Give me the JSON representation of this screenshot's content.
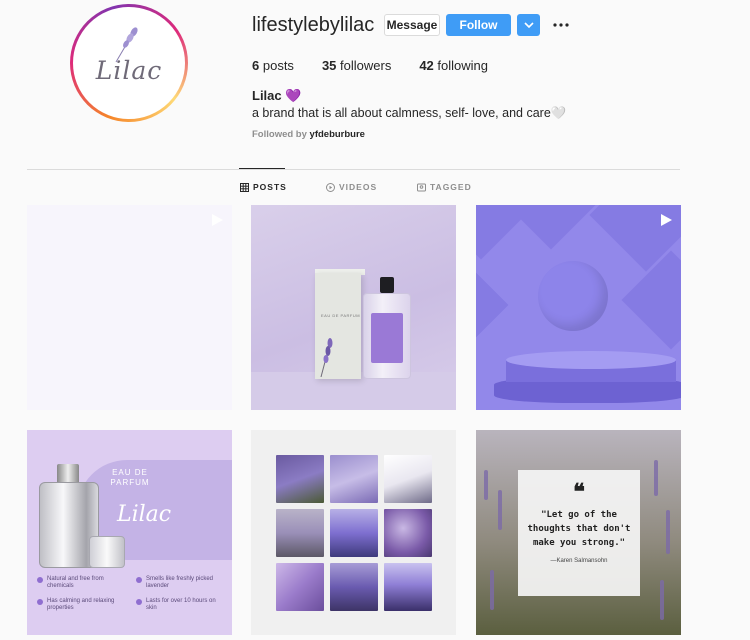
{
  "profile": {
    "username": "lifestylebylilac",
    "avatar_text": "Lilac",
    "stats": [
      {
        "count": "6",
        "label": "posts"
      },
      {
        "count": "35",
        "label": "followers"
      },
      {
        "count": "42",
        "label": "following"
      }
    ],
    "name": "Lilac 💜",
    "bio": "a brand that is all about calmness, self- love, and care🤍",
    "followed_by_prefix": "Followed by",
    "followed_by_user": "yfdeburbure"
  },
  "actions": {
    "message": "Message",
    "follow": "Follow",
    "dropdown_icon": "chevron-down-icon",
    "more_icon": "ellipsis-icon"
  },
  "tabs": [
    {
      "label": "POSTS",
      "icon": "grid-icon",
      "active": true
    },
    {
      "label": "VIDEOS",
      "icon": "play-circle-icon",
      "active": false
    },
    {
      "label": "TAGGED",
      "icon": "tag-icon",
      "active": false
    }
  ],
  "posts": {
    "p2_box_text": "EAU DE PARFUM",
    "p4_title": "EAU DE PARFUM",
    "p4_word": "Lilac",
    "p4_features": [
      "Natural and free from chemicals",
      "Smells like freshly picked lavender",
      "Has calming and relaxing properties",
      "Lasts for over 10 hours on skin"
    ],
    "quote_mark": "❝",
    "quote": "\"Let go of the thoughts that don't make you strong.\"",
    "quote_author": "—Karen Salmansohn"
  },
  "colors": {
    "accent": "#3f9cf6",
    "lilac": "#9288ea"
  }
}
